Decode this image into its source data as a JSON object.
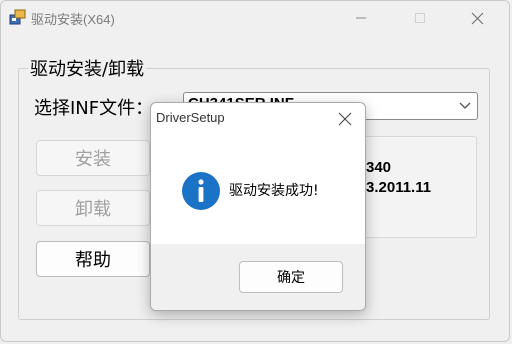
{
  "window": {
    "title": "驱动安装(X64)",
    "controls": {
      "minimize": "minimize-icon",
      "maximize": "maximize-icon",
      "close": "close-icon"
    }
  },
  "group": {
    "title": "驱动安装/卸载",
    "select_label": "选择INF文件：",
    "combo_value": "CH341SER.INF"
  },
  "buttons": {
    "install": "安装",
    "uninstall": "卸载",
    "help": "帮助"
  },
  "info": {
    "line1": "340",
    "line2": "3.2011.11"
  },
  "dialog": {
    "title": "DriverSetup",
    "message": "驱动安装成功!",
    "ok_label": "确定",
    "icon": "info-icon"
  },
  "colors": {
    "window_bg": "#f0f0f0",
    "dialog_bg": "#ffffff",
    "info_icon": "#1a73c6"
  }
}
